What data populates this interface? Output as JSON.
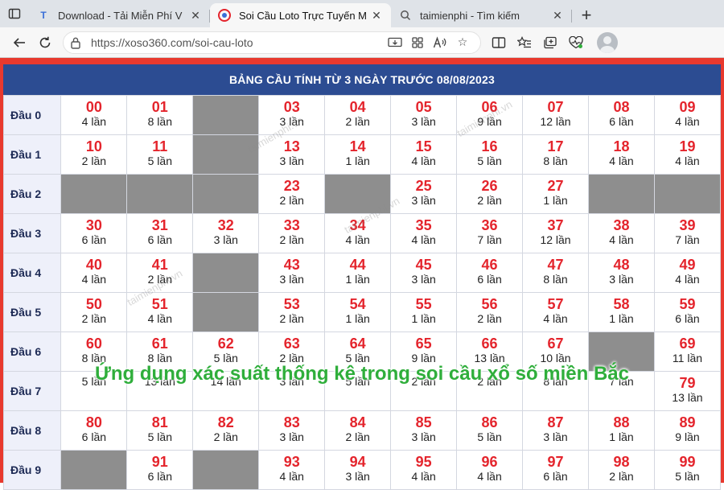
{
  "browser": {
    "tabs": [
      {
        "label": "Download - Tải Miễn Phí V",
        "favicon": "T",
        "active": false
      },
      {
        "label": "Soi Cầu Loto Trực Tuyến M",
        "favicon": "G",
        "active": true
      },
      {
        "label": "taimienphi - Tìm kiếm",
        "favicon": "search-icon",
        "active": false
      }
    ],
    "new_tab": "+",
    "url": "https://xoso360.com/soi-cau-loto"
  },
  "page": {
    "title": "BẢNG CẦU TÍNH TỪ 3 NGÀY TRƯỚC 08/08/2023",
    "accent": "#e4242c",
    "header_color": "#2c4c92",
    "empty_color": "#8e8e8e",
    "watermark": "taimienphi.vn",
    "rows": [
      {
        "label": "Đầu 0",
        "cells": [
          {
            "n": "00",
            "c": "4 lần"
          },
          {
            "n": "01",
            "c": "8 lần"
          },
          null,
          {
            "n": "03",
            "c": "3 lần"
          },
          {
            "n": "04",
            "c": "2 lần"
          },
          {
            "n": "05",
            "c": "3 lần"
          },
          {
            "n": "06",
            "c": "9 lần"
          },
          {
            "n": "07",
            "c": "12 lần"
          },
          {
            "n": "08",
            "c": "6 lần"
          },
          {
            "n": "09",
            "c": "4 lần"
          }
        ]
      },
      {
        "label": "Đầu 1",
        "cells": [
          {
            "n": "10",
            "c": "2 lần"
          },
          {
            "n": "11",
            "c": "5 lần"
          },
          null,
          {
            "n": "13",
            "c": "3 lần"
          },
          {
            "n": "14",
            "c": "1 lần"
          },
          {
            "n": "15",
            "c": "4 lần"
          },
          {
            "n": "16",
            "c": "5 lần"
          },
          {
            "n": "17",
            "c": "8 lần"
          },
          {
            "n": "18",
            "c": "4 lần"
          },
          {
            "n": "19",
            "c": "4 lần"
          }
        ]
      },
      {
        "label": "Đầu 2",
        "cells": [
          null,
          null,
          null,
          {
            "n": "23",
            "c": "2 lần"
          },
          null,
          {
            "n": "25",
            "c": "3 lần"
          },
          {
            "n": "26",
            "c": "2 lần"
          },
          {
            "n": "27",
            "c": "1 lần"
          },
          null,
          null
        ]
      },
      {
        "label": "Đầu 3",
        "cells": [
          {
            "n": "30",
            "c": "6 lần"
          },
          {
            "n": "31",
            "c": "6 lần"
          },
          {
            "n": "32",
            "c": "3 lần"
          },
          {
            "n": "33",
            "c": "2 lần"
          },
          {
            "n": "34",
            "c": "4 lần"
          },
          {
            "n": "35",
            "c": "4 lần"
          },
          {
            "n": "36",
            "c": "7 lần"
          },
          {
            "n": "37",
            "c": "12 lần"
          },
          {
            "n": "38",
            "c": "4 lần"
          },
          {
            "n": "39",
            "c": "7 lần"
          }
        ]
      },
      {
        "label": "Đầu 4",
        "cells": [
          {
            "n": "40",
            "c": "4 lần"
          },
          {
            "n": "41",
            "c": "2 lần"
          },
          null,
          {
            "n": "43",
            "c": "3 lần"
          },
          {
            "n": "44",
            "c": "1 lần"
          },
          {
            "n": "45",
            "c": "3 lần"
          },
          {
            "n": "46",
            "c": "6 lần"
          },
          {
            "n": "47",
            "c": "8 lần"
          },
          {
            "n": "48",
            "c": "3 lần"
          },
          {
            "n": "49",
            "c": "4 lần"
          }
        ]
      },
      {
        "label": "Đầu 5",
        "cells": [
          {
            "n": "50",
            "c": "2 lần"
          },
          {
            "n": "51",
            "c": "4 lần"
          },
          null,
          {
            "n": "53",
            "c": "2 lần"
          },
          {
            "n": "54",
            "c": "1 lần"
          },
          {
            "n": "55",
            "c": "1 lần"
          },
          {
            "n": "56",
            "c": "2 lần"
          },
          {
            "n": "57",
            "c": "4 lần"
          },
          {
            "n": "58",
            "c": "1 lần"
          },
          {
            "n": "59",
            "c": "6 lần"
          }
        ]
      },
      {
        "label": "Đầu 6",
        "cells": [
          {
            "n": "60",
            "c": "8 lần"
          },
          {
            "n": "61",
            "c": "8 lần"
          },
          {
            "n": "62",
            "c": "5 lần"
          },
          {
            "n": "63",
            "c": "2 lần"
          },
          {
            "n": "64",
            "c": "5 lần"
          },
          {
            "n": "65",
            "c": "9 lần"
          },
          {
            "n": "66",
            "c": "13 lần"
          },
          {
            "n": "67",
            "c": "10 lần"
          },
          null,
          {
            "n": "69",
            "c": "11 lần"
          }
        ]
      },
      {
        "label": "Đầu 7",
        "cells": [
          {
            "n": "",
            "c": "5 lần"
          },
          {
            "n": "",
            "c": "13 lần"
          },
          {
            "n": "",
            "c": "14 lần"
          },
          {
            "n": "",
            "c": "3 lần"
          },
          {
            "n": "",
            "c": "5 lần"
          },
          {
            "n": "",
            "c": "2 lần"
          },
          {
            "n": "",
            "c": "2 lần"
          },
          {
            "n": "",
            "c": "8 lần"
          },
          {
            "n": "",
            "c": "7 lần"
          },
          {
            "n": "79",
            "c": "13 lần"
          }
        ]
      },
      {
        "label": "Đầu 8",
        "cells": [
          {
            "n": "80",
            "c": "6 lần"
          },
          {
            "n": "81",
            "c": "5 lần"
          },
          {
            "n": "82",
            "c": "2 lần"
          },
          {
            "n": "83",
            "c": "3 lần"
          },
          {
            "n": "84",
            "c": "2 lần"
          },
          {
            "n": "85",
            "c": "3 lần"
          },
          {
            "n": "86",
            "c": "5 lần"
          },
          {
            "n": "87",
            "c": "3 lần"
          },
          {
            "n": "88",
            "c": "1 lần"
          },
          {
            "n": "89",
            "c": "9 lần"
          }
        ]
      },
      {
        "label": "Đầu 9",
        "cells": [
          null,
          {
            "n": "91",
            "c": "6 lần"
          },
          null,
          {
            "n": "93",
            "c": "4 lần"
          },
          {
            "n": "94",
            "c": "3 lần"
          },
          {
            "n": "95",
            "c": "4 lần"
          },
          {
            "n": "96",
            "c": "4 lần"
          },
          {
            "n": "97",
            "c": "6 lần"
          },
          {
            "n": "98",
            "c": "2 lần"
          },
          {
            "n": "99",
            "c": "5 lần"
          }
        ]
      }
    ]
  },
  "overlay": {
    "caption": "Ứng dụng xác suất thống kê trong soi cầu xổ số miền Bắc",
    "color": "#2fae3b"
  }
}
